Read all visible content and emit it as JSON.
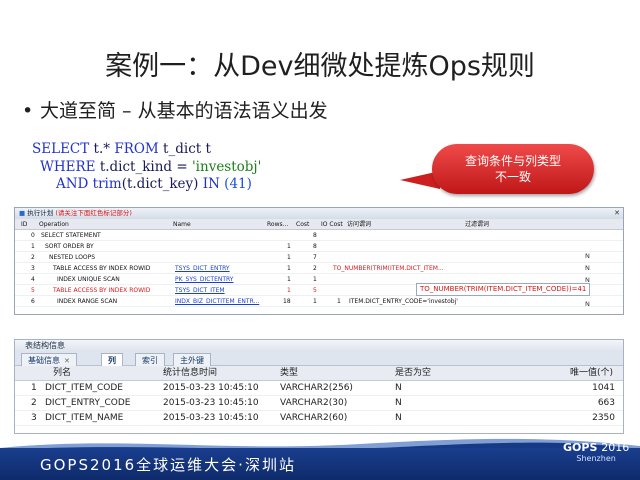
{
  "slide": {
    "title": "案例一：从Dev细微处提炼Ops规则",
    "bullet": "大道至简 – 从基本的语法语义出发"
  },
  "sql": {
    "line1_kw1": "SELECT",
    "line1_rest": " t.* ",
    "line1_kw2": "FROM",
    "line1_tail": " t_dict t",
    "line2_kw": "WHERE",
    "line2_rest": " t.dict_kind = ",
    "line2_str": "'investobj'",
    "line3_kw1": "AND",
    "line3_fn": " trim",
    "line3_rest": "(t.dict_key) ",
    "line3_kw2": "IN",
    "line3_num": " (41)"
  },
  "callout": {
    "line1": "查询条件与列类型",
    "line2": "不一致"
  },
  "plan": {
    "title": "执行计划",
    "title_note": "(请关注下面红色标记部分)",
    "headers": [
      "ID",
      "Operation",
      "Name",
      "Rows...",
      "Cost",
      "IO Cost",
      "访问谓词",
      "过滤谓词"
    ],
    "rows": [
      {
        "id": "0",
        "op": "SELECT STATEMENT",
        "name": "",
        "rows": "",
        "cost": "8",
        "io": "",
        "access": "",
        "filter": ""
      },
      {
        "id": "1",
        "op": "SORT ORDER BY",
        "name": "",
        "rows": "1",
        "cost": "8",
        "io": "",
        "access": "",
        "filter": ""
      },
      {
        "id": "2",
        "op": "NESTED LOOPS",
        "name": "",
        "rows": "1",
        "cost": "7",
        "io": "",
        "access": "",
        "filter": ""
      },
      {
        "id": "3",
        "op": "TABLE ACCESS BY INDEX ROWID",
        "name": "TSYS_DICT_ENTRY",
        "rows": "1",
        "cost": "2",
        "io": "",
        "access": "TO_NUMBER(TRIM(ITEM.DICT_ITEM...",
        "filter": ""
      },
      {
        "id": "4",
        "op": "INDEX UNIQUE SCAN",
        "name": "PK_SYS_DICTENTRY",
        "rows": "1",
        "cost": "1",
        "io": "",
        "access": "",
        "filter": ""
      },
      {
        "id": "5",
        "op": "TABLE ACCESS BY INDEX ROWID",
        "name": "TSYS_DICT_ITEM",
        "rows": "1",
        "cost": "5",
        "io": "",
        "access": "",
        "filter": ""
      },
      {
        "id": "6",
        "op": "INDEX RANGE SCAN",
        "name": "INDX_BIZ_DICTITEM_ENTR...",
        "rows": "18",
        "cost": "1",
        "io": "1",
        "access": "ITEM.DICT_ENTRY_CODE='investobj'",
        "filter": ""
      }
    ],
    "n_flags": [
      "N",
      "N",
      "N",
      "N"
    ],
    "tooltip": "TO_NUMBER(TRIM(ITEM.DICT_ITEM_CODE))=41"
  },
  "struct": {
    "title": "表结构信息",
    "tabs": [
      "基础信息",
      "列",
      "索引",
      "主外键"
    ],
    "headers": [
      "列名",
      "统计信息时间",
      "类型",
      "是否为空",
      "唯一值(个)"
    ],
    "rows": [
      {
        "n": "1",
        "col": "DICT_ITEM_CODE",
        "time": "2015-03-23 10:45:10",
        "type": "VARCHAR2(256)",
        "null": "N",
        "uniq": "1041"
      },
      {
        "n": "2",
        "col": "DICT_ENTRY_CODE",
        "time": "2015-03-23 10:45:10",
        "type": "VARCHAR2(30)",
        "null": "N",
        "uniq": "663"
      },
      {
        "n": "3",
        "col": "DICT_ITEM_NAME",
        "time": "2015-03-23 10:45:10",
        "type": "VARCHAR2(60)",
        "null": "N",
        "uniq": "2350"
      }
    ]
  },
  "footer": {
    "text": "GOPS2016全球运维大会·深圳站",
    "logo_main": "GOPS",
    "logo_year": "2016",
    "logo_sub": "Shenzhen"
  },
  "colors": {
    "footer_bg": "#163a86",
    "callout": "#d92c2c",
    "highlight": "#d81818"
  }
}
